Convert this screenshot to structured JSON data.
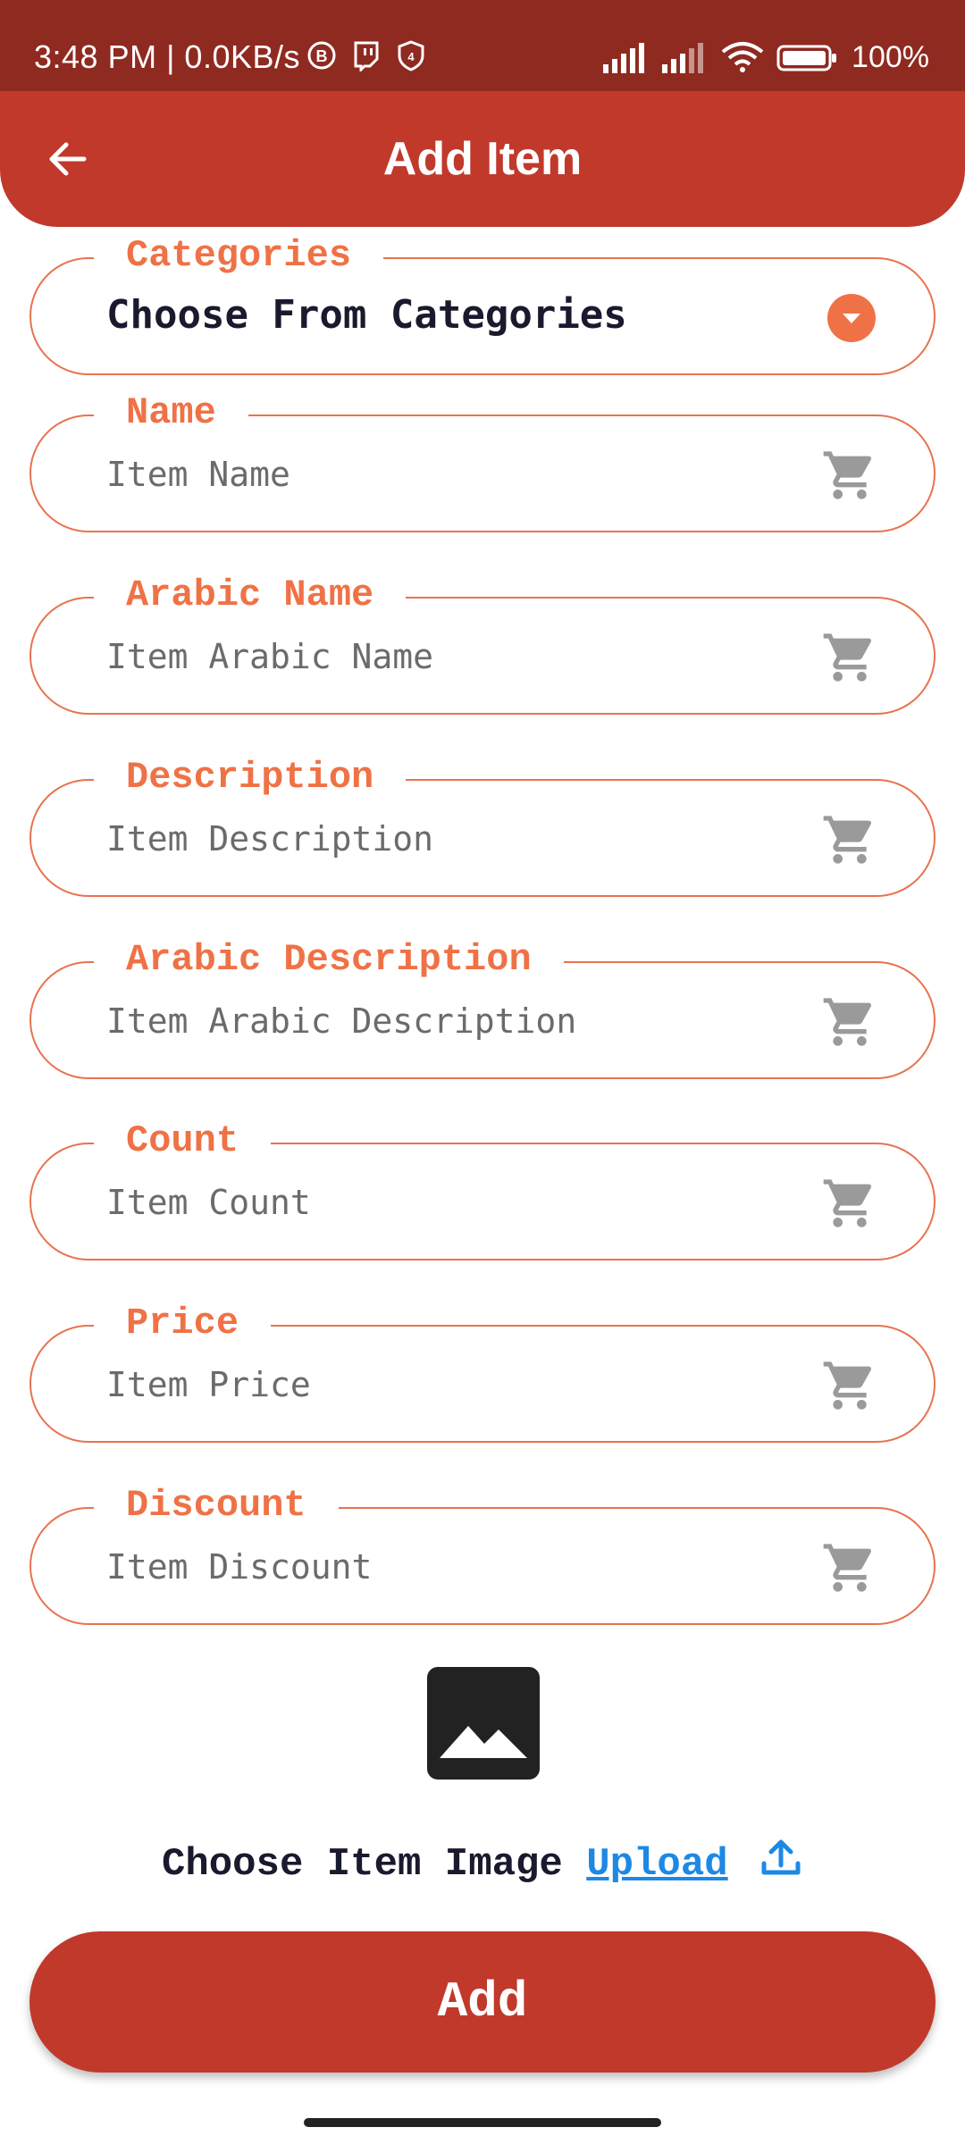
{
  "status_bar": {
    "time_text": "3:48 PM | 0.0KB/s",
    "battery": "100%"
  },
  "app_bar": {
    "title": "Add Item"
  },
  "form": {
    "categories": {
      "label": "Categories",
      "value": "Choose From Categories"
    },
    "name": {
      "label": "Name",
      "placeholder": "Item Name"
    },
    "arabic_name": {
      "label": "Arabic Name",
      "placeholder": "Item Arabic Name"
    },
    "description": {
      "label": "Description",
      "placeholder": "Item Description"
    },
    "arabic_description": {
      "label": "Arabic Description",
      "placeholder": "Item Arabic Description"
    },
    "count": {
      "label": "Count",
      "placeholder": "Item Count"
    },
    "price": {
      "label": "Price",
      "placeholder": "Item Price"
    },
    "discount": {
      "label": "Discount",
      "placeholder": "Item Discount"
    }
  },
  "image_picker": {
    "label": "Choose Item Image",
    "upload_link": "Upload"
  },
  "actions": {
    "add_label": "Add"
  },
  "colors": {
    "status_bar": "#8f2a21",
    "app_bar": "#c0392b",
    "field_border": "#e8734f",
    "label": "#ef7246",
    "link": "#1e88e5",
    "button": "#c0392b"
  },
  "icons": [
    "back-arrow-icon",
    "dropdown-icon",
    "cart-icon",
    "image-icon",
    "upload-icon"
  ]
}
